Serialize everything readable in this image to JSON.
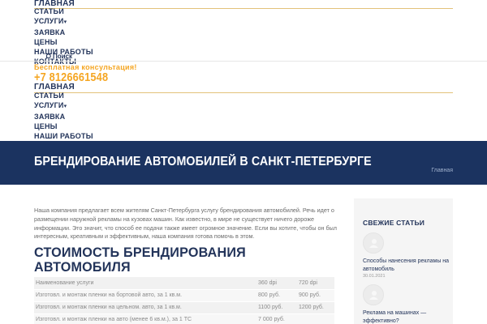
{
  "nav": {
    "items": [
      "ГЛАВНАЯ",
      "СТАТЬИ",
      "УСЛУГИ",
      "ЗАЯВКА",
      "ЦЕНЫ",
      "НАШИ РАБОТЫ",
      "КОНТАКТЫ"
    ],
    "dropdown_arrow": "▾"
  },
  "search": {
    "label": "Поиск",
    "icon": "search-icon"
  },
  "contact": {
    "consult": "Бесплатная консультация!",
    "phone": "+7 8126661548"
  },
  "banner": {
    "title": "БРЕНДИРОВАНИЕ АВТОМОБИЛЕЙ В САНКТ-ПЕТЕРБУРГЕ",
    "breadcrumb": "Главная",
    "bg_color": "#1b3360"
  },
  "main": {
    "intro": "Наша компания предлагает всем жителям Санкт-Петербурга услугу брендирования автомобилей. Речь идет о размещении наружной рекламы на кузовах машин. Как известно, в мире не существует ничего дороже информации. Это значит, что способ ее подачи также имеет огромное значение. Если вы хотите, чтобы он был интересным, креативным и эффективным, наша компания готова помочь в этом.",
    "price_title": "СТОИМОСТЬ БРЕНДИРОВАНИЯ АВТОМОБИЛЯ",
    "price_table": {
      "header": [
        "Наименование услуги",
        "360 dpi",
        "720 dpi"
      ],
      "rows": [
        [
          "Изготовл. и монтаж пленки на бортовой авто, за 1 кв.м.",
          "800 руб.",
          "900 руб."
        ],
        [
          "Изготовл. и монтаж пленки на цельном. авто, за 1 кв.м.",
          "1100 руб.",
          "1200 руб."
        ],
        [
          "Изготовл. и монтаж пленки на авто (менее 6 кв.м.), за 1 ТС",
          "7 000 руб.",
          ""
        ]
      ]
    }
  },
  "sidebar": {
    "title": "СВЕЖИЕ СТАТЬИ",
    "posts": [
      {
        "title": "Способы нанесения рекламы на автомобиль",
        "date": "30.01.2021"
      },
      {
        "title": "Реклама на машинах — эффективно?",
        "date": ""
      }
    ]
  },
  "colors": {
    "navy": "#23345a",
    "accent": "#f5a623",
    "gold_line": "#e3c27a"
  }
}
